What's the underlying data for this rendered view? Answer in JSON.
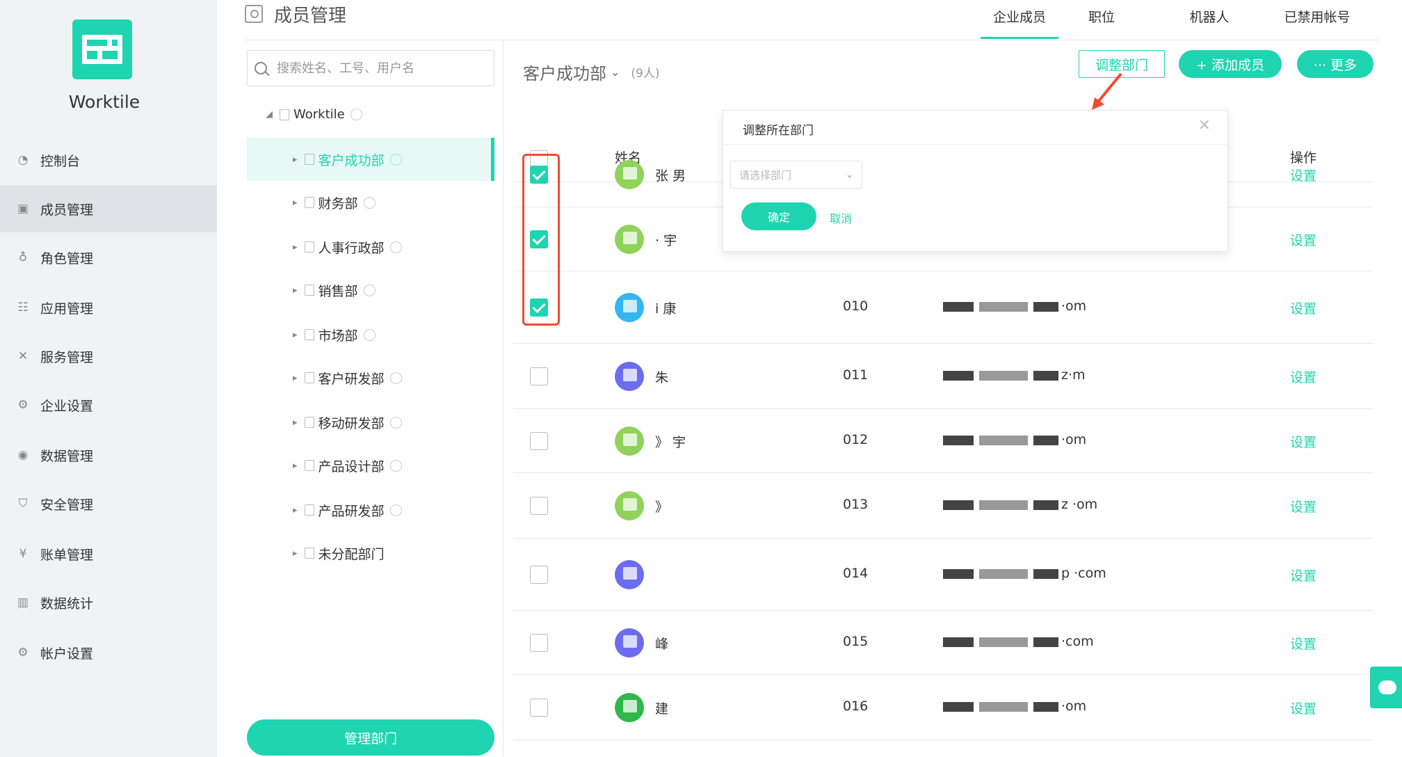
{
  "brand": "Worktile",
  "sidebar": {
    "items": [
      {
        "label": "控制台",
        "icon": "dashboard-icon"
      },
      {
        "label": "成员管理",
        "icon": "members-icon",
        "active": true
      },
      {
        "label": "角色管理",
        "icon": "role-icon"
      },
      {
        "label": "应用管理",
        "icon": "apps-icon"
      },
      {
        "label": "服务管理",
        "icon": "service-icon"
      },
      {
        "label": "企业设置",
        "icon": "enterprise-settings-icon"
      },
      {
        "label": "数据管理",
        "icon": "data-icon"
      },
      {
        "label": "安全管理",
        "icon": "shield-icon"
      },
      {
        "label": "账单管理",
        "icon": "bill-icon"
      },
      {
        "label": "数据统计",
        "icon": "stats-icon"
      },
      {
        "label": "帐户设置",
        "icon": "account-settings-icon"
      }
    ]
  },
  "header": {
    "title": "成员管理",
    "tabs": [
      "企业成员",
      "职位",
      "机器人",
      "已禁用帐号"
    ]
  },
  "dept_panel": {
    "search_placeholder": "搜索姓名、工号、用户名",
    "root": "Worktile",
    "departments": [
      "客户成功部",
      "财务部",
      "人事行政部",
      "销售部",
      "市场部",
      "客户研发部",
      "移动研发部",
      "产品设计部",
      "产品研发部",
      "未分配部门"
    ],
    "manage_button": "管理部门"
  },
  "content": {
    "dept_name": "客户成功部",
    "dept_count": "(9人)",
    "btn_adjust": "调整部门",
    "btn_add": "+ 添加成员",
    "btn_more": "··· 更多",
    "col_name": "姓名",
    "col_ops": "操作",
    "rows": [
      {
        "checked": true,
        "avatar_color": "#8fd35a",
        "name": "张  男",
        "job_no": "",
        "email": "",
        "action": "设置"
      },
      {
        "checked": true,
        "avatar_color": "#8fd35a",
        "name": "·   宇",
        "job_no": "",
        "email": "",
        "action": "设置"
      },
      {
        "checked": true,
        "avatar_color": "#33b6f2",
        "name": "i  康",
        "job_no": "010",
        "email": "·om",
        "action": "设置"
      },
      {
        "checked": false,
        "avatar_color": "#6b6cf0",
        "name": "朱",
        "job_no": "011",
        "email": "z·m",
        "action": "设置"
      },
      {
        "checked": false,
        "avatar_color": "#8fd35a",
        "name": "》 宇",
        "job_no": "012",
        "email": "·om",
        "action": "设置"
      },
      {
        "checked": false,
        "avatar_color": "#8fd35a",
        "name": "》",
        "job_no": "013",
        "email": "z  ·om",
        "action": "设置"
      },
      {
        "checked": false,
        "avatar_color": "#6b6cf0",
        "name": "",
        "job_no": "014",
        "email": "p ·com",
        "action": "设置"
      },
      {
        "checked": false,
        "avatar_color": "#6b6cf0",
        "name": "峰",
        "job_no": "015",
        "email": "·com",
        "action": "设置"
      },
      {
        "checked": false,
        "avatar_color": "#2fb84a",
        "name": "建",
        "job_no": "016",
        "email": "·om",
        "action": "设置"
      }
    ]
  },
  "popup": {
    "title": "调整所在部门",
    "select_placeholder": "请选择部门",
    "ok": "确定",
    "cancel": "取消"
  },
  "colors": {
    "accent": "#1fd4b0",
    "highlight": "#f04b2e"
  }
}
